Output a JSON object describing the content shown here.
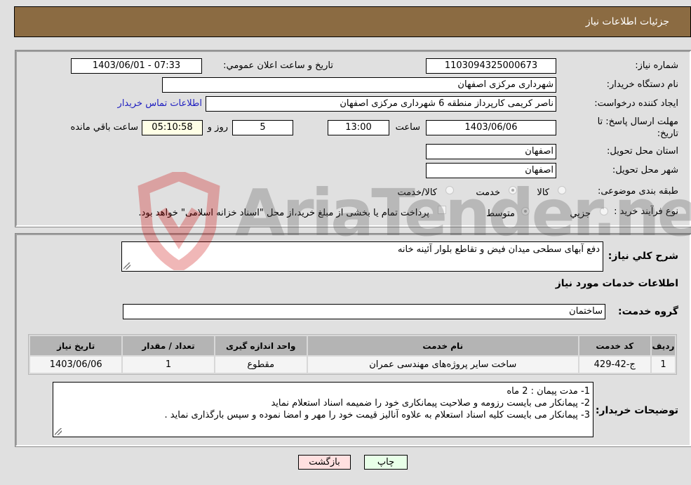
{
  "header": {
    "title": "جزئیات اطلاعات نیاز"
  },
  "form": {
    "need_number": {
      "label": "شماره نیاز:",
      "value": "1103094325000673"
    },
    "announce_datetime": {
      "label": "تاریخ و ساعت اعلان عمومي:",
      "value": "1403/06/01 - 07:33"
    },
    "buyer_org": {
      "label": "نام دستگاه خریدار:",
      "value": "شهرداری مرکزی اصفهان"
    },
    "requester": {
      "label": "ایجاد کننده درخواست:",
      "value": "ناصر کریمی کارپرداز منطقه 6 شهرداری مرکزی اصفهان"
    },
    "buyer_contact_link": "اطلاعات تماس خریدار",
    "deadline": {
      "label": "مهلت ارسال پاسخ: تا تاریخ:",
      "date": "1403/06/06",
      "time_label": "ساعت",
      "time": "13:00",
      "days": "5",
      "days_label": "روز و",
      "remaining": "05:10:58",
      "remaining_label": "ساعت باقي مانده"
    },
    "province": {
      "label": "استان محل تحویل:",
      "value": "اصفهان"
    },
    "city": {
      "label": "شهر محل تحویل:",
      "value": "اصفهان"
    },
    "category": {
      "label": "طبقه بندی موضوعی:",
      "options": [
        "کالا",
        "خدمت",
        "کالا/خدمت"
      ],
      "selected": "خدمت"
    },
    "purchase_type": {
      "label": "نوع فرآیند خرید :",
      "options": [
        "جزيي",
        "متوسط"
      ],
      "selected": "متوسط",
      "treasury_checkbox_label": "پرداخت تمام یا بخشی از مبلغ خرید،از محل \"اسناد خزانه اسلامی\" خواهد بود.",
      "treasury_checked": false
    }
  },
  "details": {
    "description_label": "شرح کلي نیاز:",
    "description": "دفع آبهای سطحی میدان فیض و تقاطع بلوار آئینه خانه",
    "services_heading": "اطلاعات خدمات مورد نیاز",
    "service_group_label": "گروه خدمت:",
    "service_group": "ساختمان",
    "table": {
      "headers": [
        "ردیف",
        "کد خدمت",
        "نام خدمت",
        "واحد اندازه گیری",
        "تعداد / مقدار",
        "تاریخ نیاز"
      ],
      "rows": [
        [
          "1",
          "ج-42-429",
          "ساخت سایر پروژه‌های مهندسی عمران",
          "مقطوع",
          "1",
          "1403/06/06"
        ]
      ]
    },
    "buyer_notes_label": "توضیحات خریدار:",
    "buyer_notes": [
      "1- مدت پیمان : 2 ماه",
      "2- پیمانکار می بایست رزومه و صلاحیت پیمانکاری خود را ضمیمه اسناد استعلام نماید",
      "3- پیمانکار می بایست کلیه اسناد استعلام به علاوه آنالیز قیمت خود را مهر و امضا نموده و سپس بارگذاری نماید ."
    ]
  },
  "buttons": {
    "print": "چاپ",
    "back": "بازگشت"
  },
  "watermark": {
    "text": "AriaTender.neT"
  }
}
